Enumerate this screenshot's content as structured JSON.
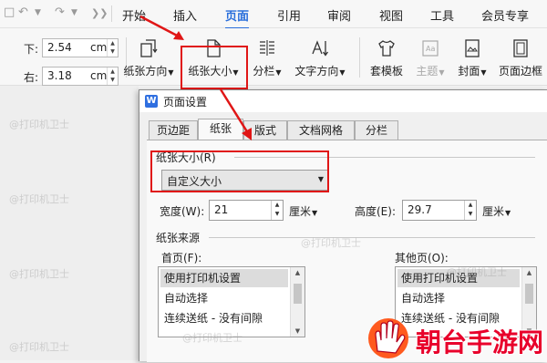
{
  "menubar": {
    "tabs": [
      {
        "label": "开始"
      },
      {
        "label": "插入"
      },
      {
        "label": "页面"
      },
      {
        "label": "引用"
      },
      {
        "label": "审阅"
      },
      {
        "label": "视图"
      },
      {
        "label": "工具"
      },
      {
        "label": "会员专享"
      }
    ],
    "active_tab": "页面",
    "accent_color": "#2a6fdb"
  },
  "ribbon": {
    "margin_bottom": {
      "label": "下:",
      "value": "2.54",
      "unit": "cm"
    },
    "margin_right": {
      "label": "右:",
      "value": "3.18",
      "unit": "cm"
    },
    "buttons": {
      "orientation": "纸张方向",
      "size": "纸张大小",
      "columns": "分栏",
      "text_direction": "文字方向",
      "template": "套模板",
      "theme": "主题",
      "cover": "封面",
      "page_border": "页面边框"
    }
  },
  "dialog": {
    "title": "页面设置",
    "logo": "W",
    "tabs": [
      "页边距",
      "纸张",
      "版式",
      "文档网格",
      "分栏"
    ],
    "selected_tab": "纸张",
    "paper_size_group": "纸张大小(R)",
    "paper_size_value": "自定义大小",
    "width_label": "宽度(W):",
    "width_value": "21",
    "height_label": "高度(E):",
    "height_value": "29.7",
    "unit": "厘米",
    "paper_source_group": "纸张来源",
    "first_page_label": "首页(F):",
    "other_pages_label": "其他页(O):",
    "first_page_items": [
      "使用打印机设置",
      "自动选择",
      "连续送纸 - 没有间隙"
    ],
    "other_pages_items": [
      "使用打印机设置",
      "自动选择",
      "连续送纸 - 没有间隙"
    ]
  },
  "watermark": "@打印机卫士",
  "brand": "朝台手游网",
  "highlight_color": "#e01616"
}
